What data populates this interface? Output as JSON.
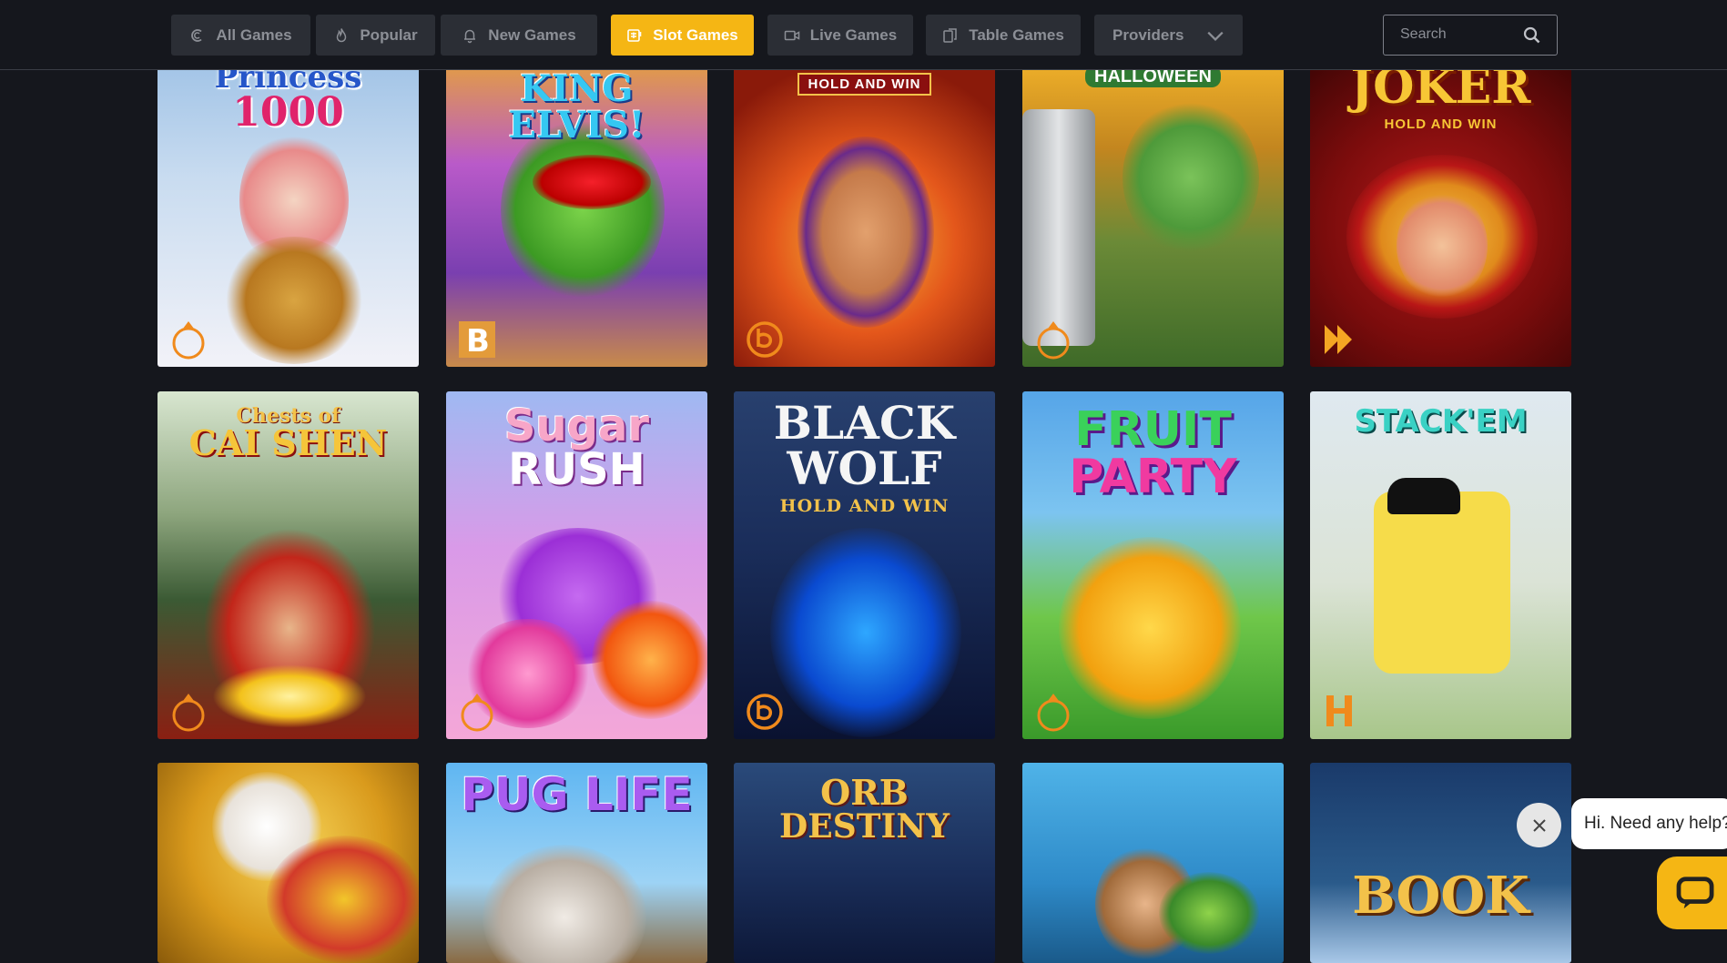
{
  "nav": {
    "tabs": [
      {
        "label": "All Games",
        "icon": "casino-chip-icon",
        "active": false
      },
      {
        "label": "Popular",
        "icon": "flame-icon",
        "active": false
      },
      {
        "label": "New Games",
        "icon": "bell-icon",
        "active": false
      },
      {
        "label": "Slot Games",
        "icon": "slot-machine-icon",
        "active": true
      },
      {
        "label": "Live Games",
        "icon": "live-camera-icon",
        "active": false
      },
      {
        "label": "Table Games",
        "icon": "cards-icon",
        "active": false
      }
    ],
    "providers_label": "Providers",
    "search_placeholder": "Search"
  },
  "colors": {
    "background": "#15171d",
    "tab_bg": "#2b2e35",
    "tab_text": "#8c8f96",
    "accent": "#f5b614"
  },
  "games": [
    {
      "title_1": "Princess",
      "title_2": "1000",
      "title_3": "",
      "provider_icon": "pragmatic-play-icon"
    },
    {
      "title_1": "KING ELVIS!",
      "title_2": "",
      "title_3": "",
      "provider_icon": "booming-games-icon"
    },
    {
      "title_1": "",
      "title_2": "",
      "title_3": "HOLD AND WIN",
      "provider_icon": "booongo-icon"
    },
    {
      "title_1": "HALLOWEEN",
      "title_2": "",
      "title_3": "",
      "provider_icon": "pragmatic-play-icon"
    },
    {
      "title_1": "JOKER",
      "title_2": "",
      "title_3": "HOLD AND WIN",
      "provider_icon": "playson-icon"
    },
    {
      "title_1": "Chests of",
      "title_2": "CAI SHEN",
      "title_3": "",
      "provider_icon": "pragmatic-play-icon"
    },
    {
      "title_1": "Sugar",
      "title_2": "RUSH",
      "title_3": "",
      "provider_icon": "pragmatic-play-icon"
    },
    {
      "title_1": "BLACK",
      "title_2": "WOLF",
      "title_3": "HOLD AND WIN",
      "provider_icon": "booongo-icon"
    },
    {
      "title_1": "FRUIT",
      "title_2": "PARTY",
      "title_3": "",
      "provider_icon": "pragmatic-play-icon"
    },
    {
      "title_1": "STACK'EM",
      "title_2": "",
      "title_3": "",
      "provider_icon": "hacksaw-icon"
    },
    {
      "title_1": "",
      "title_2": "",
      "title_3": "",
      "provider_icon": ""
    },
    {
      "title_1": "PUG LIFE",
      "title_2": "",
      "title_3": "",
      "provider_icon": ""
    },
    {
      "title_1": "ORB",
      "title_2": "DESTINY",
      "title_3": "",
      "provider_icon": ""
    },
    {
      "title_1": "",
      "title_2": "",
      "title_3": "",
      "provider_icon": ""
    },
    {
      "title_1": "BOOK",
      "title_2": "",
      "title_3": "",
      "provider_icon": ""
    }
  ],
  "chat": {
    "greeting": "Hi. Need any help?"
  }
}
